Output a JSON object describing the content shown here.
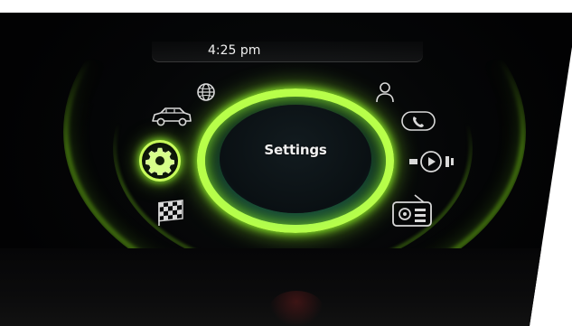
{
  "status_bar": {
    "time": "4:25 pm"
  },
  "center": {
    "selected_label": "Settings"
  },
  "menu_items": [
    {
      "name": "navigation",
      "icon": "globe-icon"
    },
    {
      "name": "vehicle",
      "icon": "car-icon"
    },
    {
      "name": "settings",
      "icon": "gear-icon",
      "selected": true
    },
    {
      "name": "race",
      "icon": "checkered-flag-icon"
    },
    {
      "name": "contacts",
      "icon": "person-icon"
    },
    {
      "name": "phone",
      "icon": "phone-icon"
    },
    {
      "name": "media",
      "icon": "media-icon"
    },
    {
      "name": "radio",
      "icon": "radio-icon"
    }
  ],
  "colors": {
    "accent": "#b8ff4a",
    "background": "#050607",
    "icon": "#d9d9d9"
  }
}
